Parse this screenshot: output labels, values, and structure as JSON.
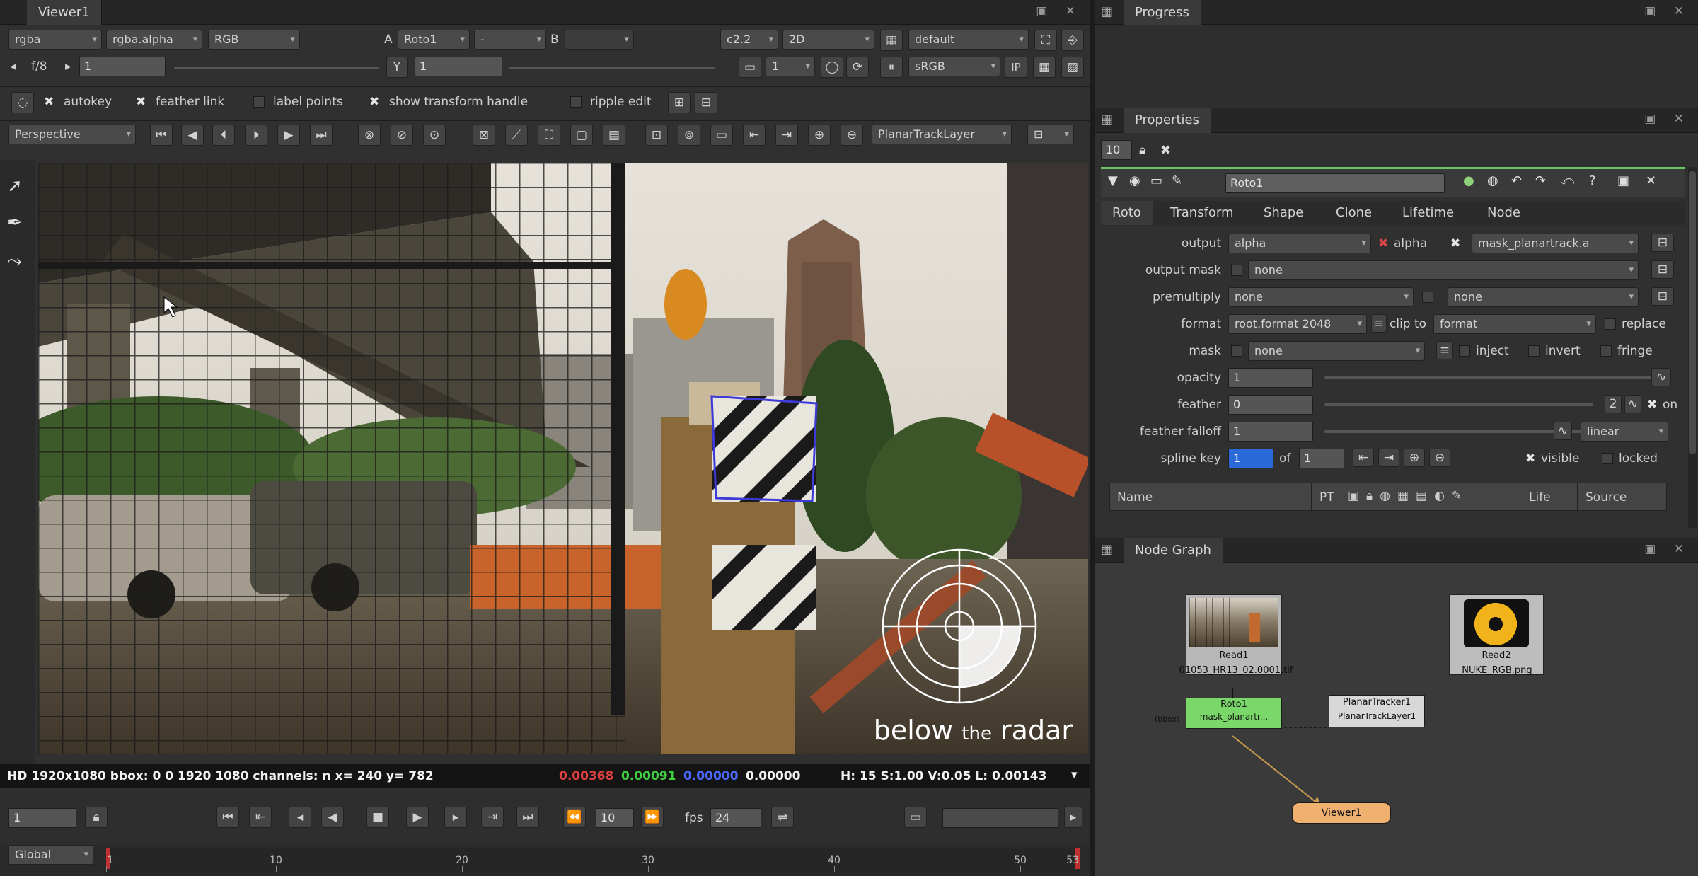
{
  "viewer": {
    "tab_title": "Viewer1",
    "toolbar1": {
      "channels": "rgba",
      "channel_alpha": "rgba.alpha",
      "display": "RGB",
      "a_label": "A",
      "a_input": "Roto1",
      "a_op": "-",
      "b_label": "B",
      "gain": "c2.2",
      "view": "2D",
      "lut": "default"
    },
    "toolbar2": {
      "frame": "f/8",
      "frame_value": "1",
      "y_label": "Y",
      "y_value": "1",
      "proxy": "1",
      "colorspace": "sRGB",
      "ip_label": "IP"
    },
    "roto_toolbar": {
      "autokey": "autokey",
      "feather_link": "feather link",
      "label_points": "label points",
      "show_transform_handle": "show transform handle",
      "ripple_edit": "ripple edit"
    },
    "transform_toolbar": {
      "mode": "Perspective",
      "layer": "PlanarTrackLayer"
    },
    "watermark": {
      "below": "below",
      "the": "the",
      "radar": "radar"
    },
    "info_bar": {
      "format_info": "HD 1920x1080 bbox: 0 0 1920 1080 channels: n  x= 240 y= 782",
      "r": "0.00368",
      "g": "0.00091",
      "b": "0.00000",
      "a": "0.00000",
      "hsvl": "H: 15 S:1.00 V:0.05  L: 0.00143"
    },
    "transport": {
      "frame": "1",
      "step": "10",
      "fps_label": "fps",
      "fps": "24",
      "scope": "Global"
    },
    "timeline": {
      "ticks": [
        "1",
        "10",
        "20",
        "30",
        "40",
        "50",
        "53"
      ]
    }
  },
  "progress": {
    "tab_title": "Progress"
  },
  "properties": {
    "tab_title": "Properties",
    "max_panels": "10",
    "node_name": "Roto1",
    "tabs": [
      "Roto",
      "Transform",
      "Shape",
      "Clone",
      "Lifetime",
      "Node"
    ],
    "output": {
      "label": "output",
      "value": "alpha",
      "alpha_label": "alpha",
      "mask": "mask_planartrack.a"
    },
    "output_mask": {
      "label": "output mask",
      "value": "none"
    },
    "premultiply": {
      "label": "premultiply",
      "value": "none",
      "value2": "none"
    },
    "format": {
      "label": "format",
      "value": "root.format 2048",
      "clip_to": "clip to",
      "clip_value": "format",
      "replace": "replace"
    },
    "mask": {
      "label": "mask",
      "value": "none",
      "inject": "inject",
      "invert": "invert",
      "fringe": "fringe"
    },
    "opacity": {
      "label": "opacity",
      "value": "1"
    },
    "feather": {
      "label": "feather",
      "value": "0",
      "count": "2",
      "on": "on"
    },
    "feather_falloff": {
      "label": "feather falloff",
      "value": "1",
      "type": "linear"
    },
    "spline_key": {
      "label": "spline key",
      "value": "1",
      "of": "of",
      "total": "1",
      "visible": "visible",
      "locked": "locked"
    },
    "curves_header": {
      "name": "Name",
      "pt": "PT",
      "life": "Life",
      "source": "Source"
    }
  },
  "node_graph": {
    "tab_title": "Node Graph",
    "nodes": {
      "read1": {
        "name": "Read1",
        "file": "01053_HR13_02.0001.tif"
      },
      "read2": {
        "name": "Read2",
        "file": "NUKE_RGB.png"
      },
      "roto1": {
        "name": "Roto1",
        "sub": "mask_planartr..."
      },
      "planar": {
        "name": "PlanarTracker1",
        "sub": "PlanarTrackLayer1"
      },
      "viewer": {
        "name": "Viewer1"
      },
      "bbox_label": "(bbox)",
      "dots": "..."
    }
  },
  "colors": {
    "roto_green": "#7ad86a",
    "viewer_orange": "#f0b070",
    "red_value": "#e04040",
    "green_value": "#40d040",
    "blue_value": "#4060ff",
    "key_blue": "#2a6ad8"
  },
  "icons": {
    "lock": "lock-icon",
    "play": "play-icon",
    "stop": "stop-icon"
  }
}
